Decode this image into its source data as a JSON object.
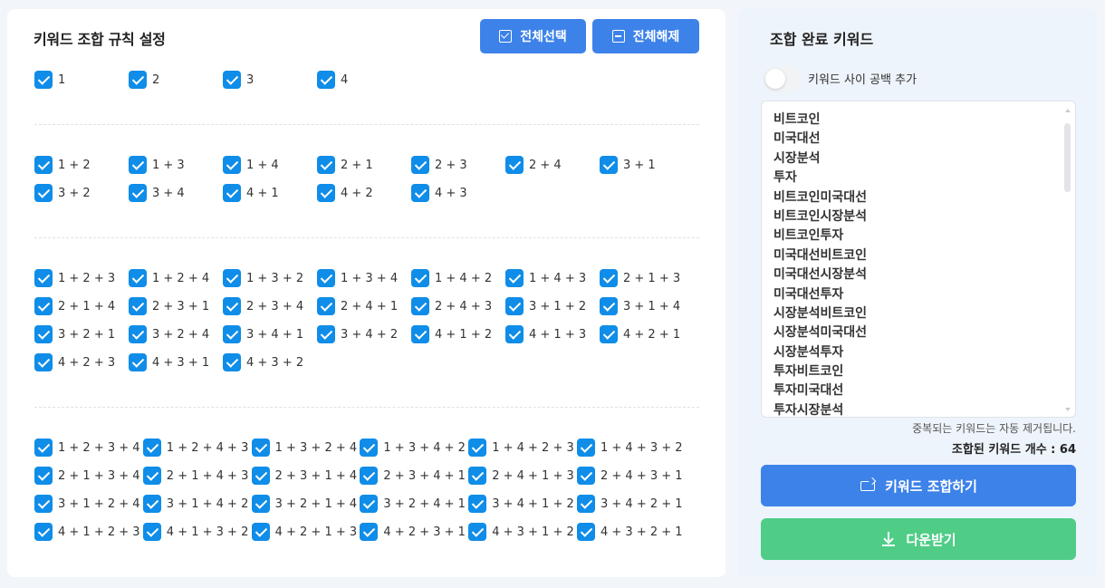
{
  "left_panel": {
    "title": "키워드 조합 규칙 설정",
    "select_all_label": "전체선택",
    "deselect_all_label": "전체해제",
    "icons": {
      "select_all": "checkbox-checked-icon",
      "deselect_all": "checkbox-minus-icon"
    },
    "groups": [
      {
        "items": [
          "1",
          "2",
          "3",
          "4"
        ]
      },
      {
        "items": [
          "1 + 2",
          "1 + 3",
          "1 + 4",
          "2 + 1",
          "2 + 3",
          "2 + 4",
          "3 + 1",
          "3 + 2",
          "3 + 4",
          "4 + 1",
          "4 + 2",
          "4 + 3"
        ]
      },
      {
        "items": [
          "1 + 2 + 3",
          "1 + 2 + 4",
          "1 + 3 + 2",
          "1 + 3 + 4",
          "1 + 4 + 2",
          "1 + 4 + 3",
          "2 + 1 + 3",
          "2 + 1 + 4",
          "2 + 3 + 1",
          "2 + 3 + 4",
          "2 + 4 + 1",
          "2 + 4 + 3",
          "3 + 1 + 2",
          "3 + 1 + 4",
          "3 + 2 + 1",
          "3 + 2 + 4",
          "3 + 4 + 1",
          "3 + 4 + 2",
          "4 + 1 + 2",
          "4 + 1 + 3",
          "4 + 2 + 1",
          "4 + 2 + 3",
          "4 + 3 + 1",
          "4 + 3 + 2"
        ]
      },
      {
        "items": [
          "1 + 2 + 3 + 4",
          "1 + 2 + 4 + 3",
          "1 + 3 + 2 + 4",
          "1 + 3 + 4 + 2",
          "1 + 4 + 2 + 3",
          "1 + 4 + 3 + 2",
          "2 + 1 + 3 + 4",
          "2 + 1 + 4 + 3",
          "2 + 3 + 1 + 4",
          "2 + 3 + 4 + 1",
          "2 + 4 + 1 + 3",
          "2 + 4 + 3 + 1",
          "3 + 1 + 2 + 4",
          "3 + 1 + 4 + 2",
          "3 + 2 + 1 + 4",
          "3 + 2 + 4 + 1",
          "3 + 4 + 1 + 2",
          "3 + 4 + 2 + 1",
          "4 + 1 + 2 + 3",
          "4 + 1 + 3 + 2",
          "4 + 2 + 1 + 3",
          "4 + 2 + 3 + 1",
          "4 + 3 + 1 + 2",
          "4 + 3 + 2 + 1"
        ]
      }
    ],
    "all_checked": true
  },
  "right_panel": {
    "title": "조합 완료 키워드",
    "toggle_label": "키워드 사이 공백 추가",
    "toggle_on": false,
    "keywords": [
      "비트코인",
      "미국대선",
      "시장분석",
      "투자",
      "비트코인미국대선",
      "비트코인시장분석",
      "비트코인투자",
      "미국대선비트코인",
      "미국대선시장분석",
      "미국대선투자",
      "시장분석비트코인",
      "시장분석미국대선",
      "시장분석투자",
      "투자비트코인",
      "투자미국대선",
      "투자시장분석"
    ],
    "dedupe_note": "중복되는 키워드는 자동 제거됩니다.",
    "count_text": "조합된 키워드 개수 : 64",
    "combine_label": "키워드 조합하기",
    "download_label": "다운받기",
    "icons": {
      "combine": "repeat-icon",
      "download": "download-icon"
    },
    "colors": {
      "primary": "#3d82e9",
      "download": "#4fcd87",
      "checkbox": "#0f8de8"
    }
  }
}
